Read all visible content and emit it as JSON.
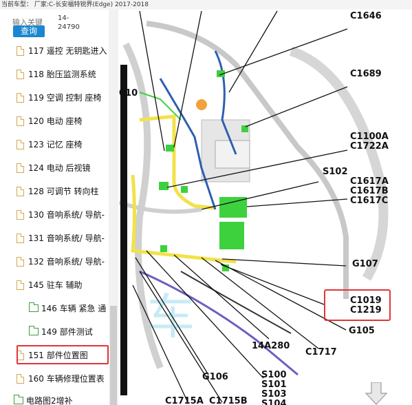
{
  "window": {
    "title": "当前车型： 厂家:C-长安福特锐界(Edge) 2017-2018"
  },
  "search": {
    "placeholder": "输入关键",
    "button_label": "查询",
    "result_line1": "14-",
    "result_line2": "24790"
  },
  "tree": {
    "items": [
      {
        "label": "117 遥控 无钥匙进入",
        "kind": "file",
        "indent": 0
      },
      {
        "label": "118 胎压监测系统",
        "kind": "file",
        "indent": 0
      },
      {
        "label": "119 空调 控制 座椅",
        "kind": "file",
        "indent": 0
      },
      {
        "label": "120 电动 座椅",
        "kind": "file",
        "indent": 0
      },
      {
        "label": "123 记忆 座椅",
        "kind": "file",
        "indent": 0
      },
      {
        "label": "124 电动 后视镜",
        "kind": "file",
        "indent": 0
      },
      {
        "label": "128 可调节 转向柱",
        "kind": "file",
        "indent": 0
      },
      {
        "label": "130 音响系统/ 导航-",
        "kind": "file",
        "indent": 0
      },
      {
        "label": "131 音响系统/ 导航-",
        "kind": "file",
        "indent": 0
      },
      {
        "label": "132 音响系统/ 导航-",
        "kind": "file",
        "indent": 0
      },
      {
        "label": "145 驻车 辅助",
        "kind": "file",
        "indent": 0
      },
      {
        "label": "146 车辆 紧急 通",
        "kind": "folder",
        "indent": 1
      },
      {
        "label": "149 部件测试",
        "kind": "folder",
        "indent": 1
      },
      {
        "label": "151 部件位置图",
        "kind": "file",
        "indent": 0,
        "selected": true
      },
      {
        "label": "160 车辆修理位置表",
        "kind": "file",
        "indent": 0
      },
      {
        "label": "电路图2增补",
        "kind": "folder",
        "indent": -1
      }
    ]
  },
  "diagram": {
    "labels": [
      {
        "text": "C1646"
      },
      {
        "text": "C1689"
      },
      {
        "text": "C1100A"
      },
      {
        "text": "C1722A"
      },
      {
        "text": "S102"
      },
      {
        "text": "C1617A"
      },
      {
        "text": "C1617B"
      },
      {
        "text": "C1617C"
      },
      {
        "text": "G107"
      },
      {
        "text": "C1019"
      },
      {
        "text": "C1219"
      },
      {
        "text": "G105"
      },
      {
        "text": "C1717"
      },
      {
        "text": "14A280"
      },
      {
        "text": "G106"
      },
      {
        "text": "S100"
      },
      {
        "text": "S101"
      },
      {
        "text": "S103"
      },
      {
        "text": "S104"
      },
      {
        "text": "C1715A"
      },
      {
        "text": "C1715B"
      },
      {
        "text": "010"
      }
    ],
    "colors": {
      "harness_yellow": "#f2e24a",
      "harness_blue": "#2d5fb0",
      "connector_green": "#3ed13e",
      "callout_red": "#e0343a"
    }
  }
}
